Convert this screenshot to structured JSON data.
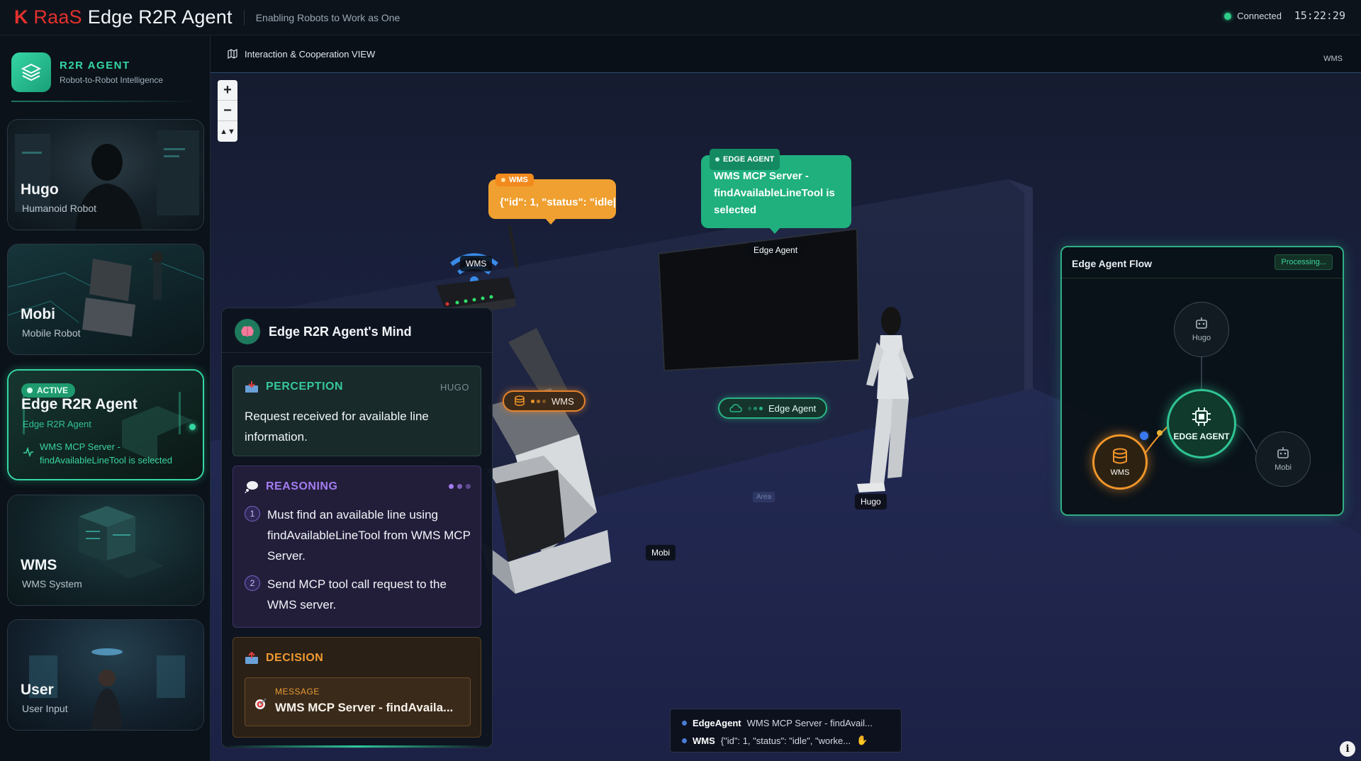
{
  "header": {
    "brand_k": "K",
    "brand_raas": "RaaS",
    "brand_title": "Edge R2R Agent",
    "tagline": "Enabling Robots to Work as One",
    "connection": "Connected",
    "time": "15:22:29"
  },
  "sidebar": {
    "logo_title": "R2R AGENT",
    "logo_subtitle": "Robot-to-Robot Intelligence",
    "agents": [
      {
        "name": "Hugo",
        "role": "Humanoid Robot"
      },
      {
        "name": "Mobi",
        "role": "Mobile Robot"
      },
      {
        "name": "Edge R2R Agent",
        "role": "Edge R2R Agent",
        "badge": "ACTIVE",
        "message": "WMS MCP Server - findAvailableLineTool is selected"
      },
      {
        "name": "WMS",
        "role": "WMS System"
      },
      {
        "name": "User",
        "role": "User Input"
      }
    ]
  },
  "view": {
    "title": "Interaction & Cooperation VIEW",
    "right_tag": "WMS",
    "zoom_in": "+",
    "zoom_out": "−",
    "reset": "▲▼"
  },
  "scene": {
    "wms_bubble_tag": "WMS",
    "wms_bubble_text": "{\"id\": 1, \"status\": \"idle|",
    "edge_bubble_tag": "EDGE AGENT",
    "edge_bubble_text": "WMS MCP Server - findAvailableLineTool is selected",
    "label_wms": "WMS",
    "label_edge_agent": "Edge Agent",
    "label_mobi": "Mobi",
    "label_hugo": "Hugo",
    "pill_wms": "WMS",
    "pill_edge": "Edge Agent",
    "area_tag": "Area"
  },
  "mind": {
    "title": "Edge R2R Agent's Mind",
    "perception": {
      "label": "PERCEPTION",
      "source": "HUGO",
      "text": "Request received for available line information."
    },
    "reasoning": {
      "label": "REASONING",
      "steps": [
        {
          "num": "1",
          "text": "Must find an available line using findAvailableLineTool from WMS MCP Server."
        },
        {
          "num": "2",
          "text": "Send MCP tool call request to the WMS server."
        }
      ]
    },
    "decision": {
      "label": "DECISION",
      "message_label": "MESSAGE",
      "message_value": "WMS MCP Server - findAvaila..."
    }
  },
  "flow": {
    "title": "Edge Agent Flow",
    "status": "Processing...",
    "nodes": {
      "hugo": "Hugo",
      "edge": "EDGE AGENT",
      "wms": "WMS",
      "mobi": "Mobi"
    }
  },
  "log": [
    {
      "source": "EdgeAgent",
      "text": "WMS MCP Server - findAvail..."
    },
    {
      "source": "WMS",
      "text": "{\"id\": 1, \"status\": \"idle\", \"worke..."
    }
  ],
  "colors": {
    "brand_red": "#e3312d",
    "accent_green": "#35d6a4",
    "wms_orange": "#f0a030",
    "reasoning_purple": "#a47cf0"
  }
}
